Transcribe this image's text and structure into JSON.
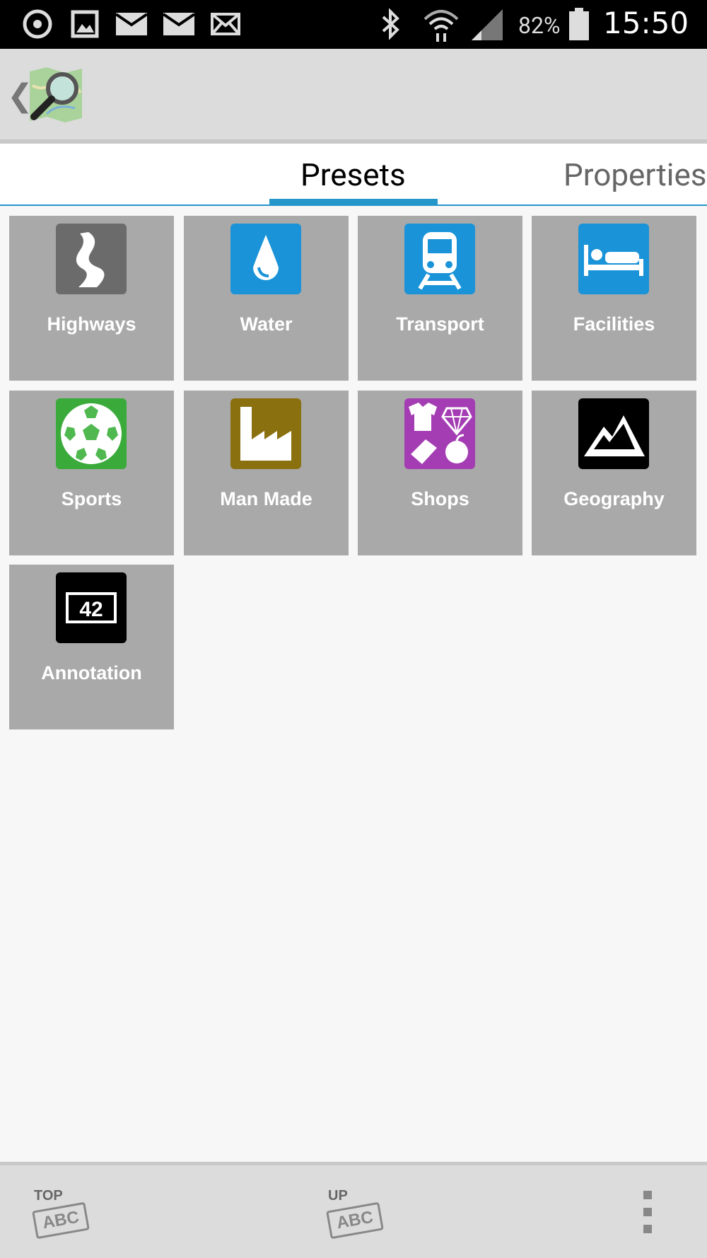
{
  "status_bar": {
    "battery": "82%",
    "time": "15:50",
    "icons": [
      "sync-icon",
      "image-icon",
      "mail-icon",
      "mail-icon",
      "mail-icon",
      "bluetooth-icon",
      "wifi-icon",
      "signal-icon",
      "battery-icon"
    ]
  },
  "tabs": [
    {
      "label": "Presets",
      "active": true
    },
    {
      "label": "Properties",
      "active": false
    }
  ],
  "presets": [
    {
      "label": "Highways",
      "icon": "highway-icon",
      "color": "#6b6b6b"
    },
    {
      "label": "Water",
      "icon": "water-drop-icon",
      "color": "#1a93d8"
    },
    {
      "label": "Transport",
      "icon": "train-icon",
      "color": "#1a93d8"
    },
    {
      "label": "Facilities",
      "icon": "bed-icon",
      "color": "#1a93d8"
    },
    {
      "label": "Sports",
      "icon": "soccer-ball-icon",
      "color": "#3aaa3a"
    },
    {
      "label": "Man Made",
      "icon": "factory-icon",
      "color": "#8a700f"
    },
    {
      "label": "Shops",
      "icon": "shopping-icon",
      "color": "#a43db3"
    },
    {
      "label": "Geography",
      "icon": "mountain-icon",
      "color": "#000000"
    },
    {
      "label": "Annotation",
      "icon": "annotation-42-icon",
      "color": "#000000",
      "badge": "42"
    }
  ],
  "bottom_bar": {
    "top_label": "TOP",
    "up_label": "UP",
    "abc": "ABC"
  }
}
